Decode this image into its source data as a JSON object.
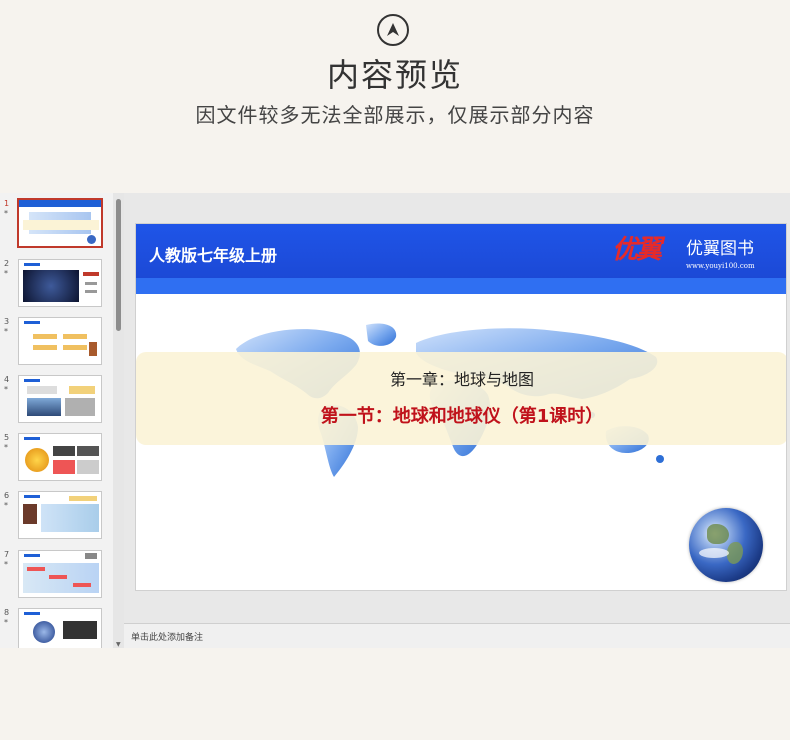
{
  "header": {
    "icon": "chevron-up-icon",
    "title": "内容预览",
    "subtitle": "因文件较多无法全部展示，仅展示部分内容"
  },
  "thumbnails": [
    {
      "number": "1",
      "star": "*",
      "active": true
    },
    {
      "number": "2",
      "star": "*",
      "active": false
    },
    {
      "number": "3",
      "star": "*",
      "active": false
    },
    {
      "number": "4",
      "star": "*",
      "active": false
    },
    {
      "number": "5",
      "star": "*",
      "active": false
    },
    {
      "number": "6",
      "star": "*",
      "active": false
    },
    {
      "number": "7",
      "star": "*",
      "active": false
    },
    {
      "number": "8",
      "star": "*",
      "active": false
    }
  ],
  "slide": {
    "edition": "人教版七年级上册",
    "brand_mark": "优翼",
    "brand_name": "优翼图书",
    "brand_url": "www.youyi100.com",
    "chapter": "第一章：地球与地图",
    "section": "第一节：地球和地球仪（第1课时）"
  },
  "notes": {
    "placeholder": "单击此处添加备注"
  },
  "colors": {
    "page_bg": "#f6f3ee",
    "slide_header_blue": "#1f55e8",
    "accent_red": "#c0121b",
    "banner_bg": "#fbf3d6"
  }
}
